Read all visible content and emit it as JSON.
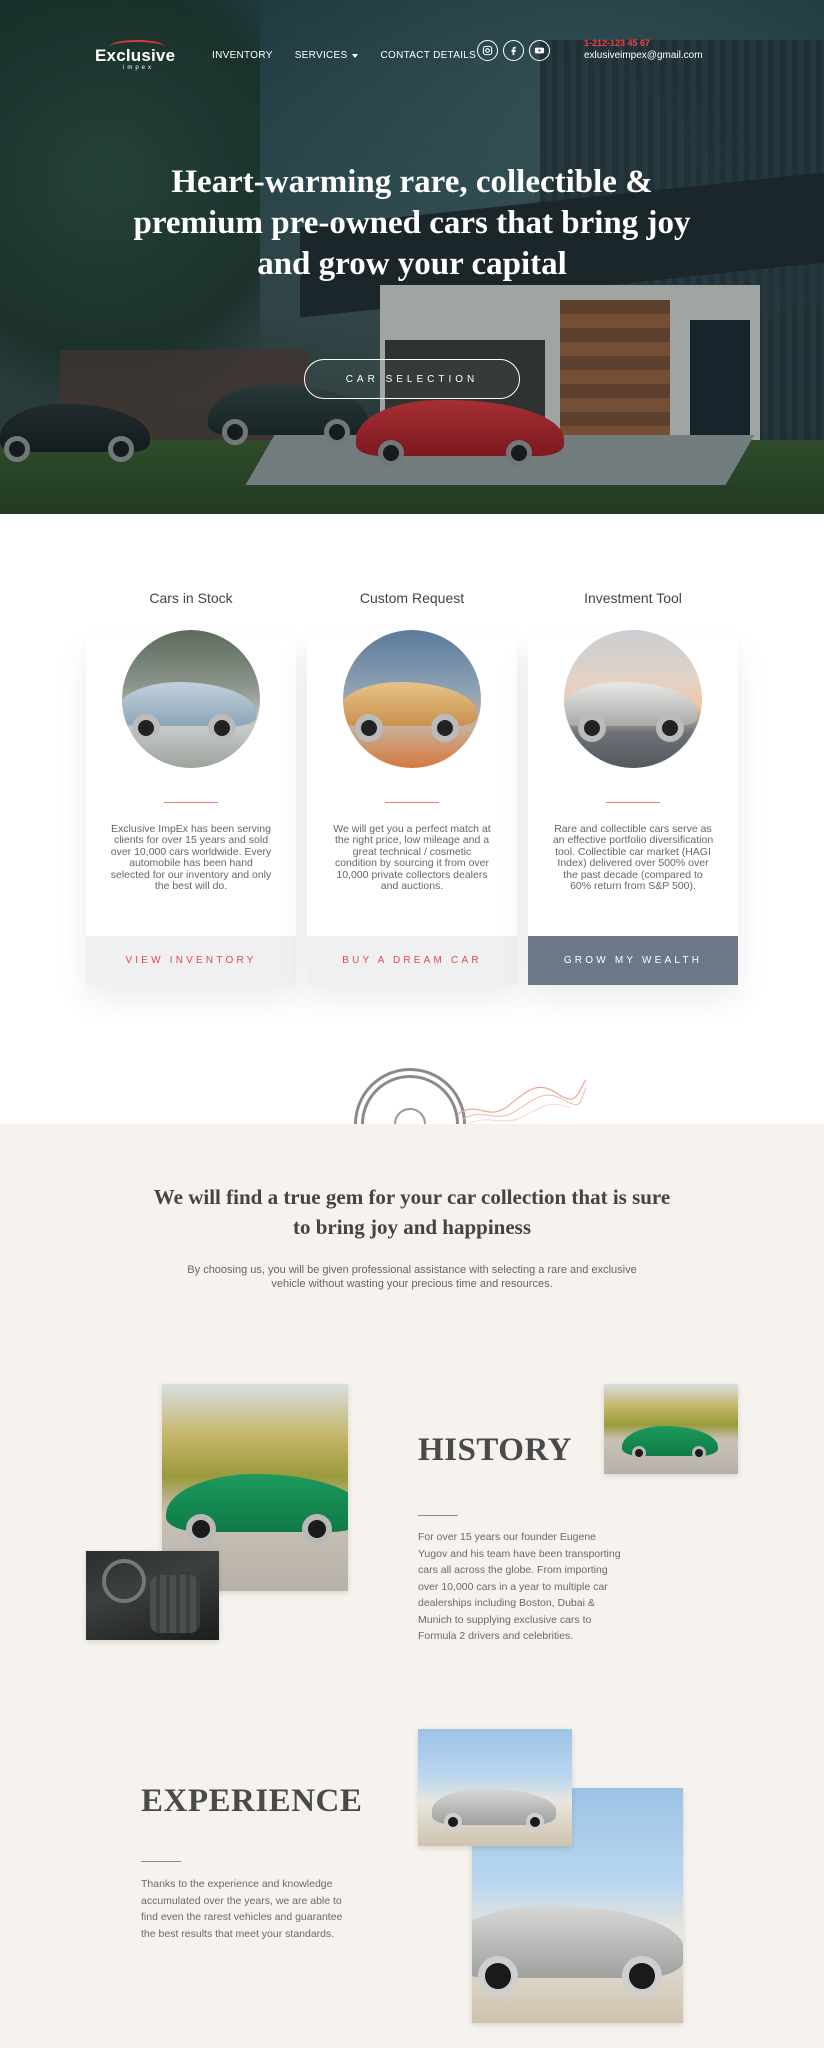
{
  "brand": {
    "name": "Exclusive",
    "sub": "impex",
    "accent": "#ef3c44"
  },
  "nav": {
    "items": [
      {
        "label": "INVENTORY"
      },
      {
        "label": "SERVICES"
      },
      {
        "label": "CONTACT DETAILS"
      }
    ]
  },
  "socials": [
    "instagram-icon",
    "facebook-icon",
    "youtube-icon"
  ],
  "contact": {
    "phone": "1-212-123 45 67",
    "email": "exlusiveimpex@gmail.com"
  },
  "hero": {
    "title": "Heart-warming rare, collectible & premium pre-owned cars that bring joy and grow your capital",
    "button": "CAR SELECTION"
  },
  "services": [
    {
      "heading": "Cars in Stock",
      "text": "Exclusive ImpEx has been serving clients for over 15 years and sold over 10,000 cars worldwide. Every automobile has been hand selected for our inventory and only the best will do.",
      "button": "VIEW INVENTORY"
    },
    {
      "heading": "Custom Request",
      "text": "We will get you a perfect match at the right price, low mileage and a great technical / cosmetic condition by sourcing it from over 10,000 private collectors dealers and auctions.",
      "button": "BUY A DREAM CAR"
    },
    {
      "heading": "Investment Tool",
      "text": "Rare and collectible cars serve as an effective portfolio diversification tool. Collectible car market (HAGI Index) delivered over 500% over the past decade (compared to 60% return from S&P 500).",
      "button": "GROW MY WEALTH"
    }
  ],
  "gem": {
    "title": "We will find a true gem for your car collection that is sure to bring joy and happiness",
    "subtitle": "By choosing us, you will be given professional assistance with selecting a rare and exclusive vehicle without wasting your precious time and resources."
  },
  "history": {
    "title": "HISTORY",
    "text": "For over 15 years our founder Eugene Yugov and his team have been transporting cars all across the globe. From importing over 10,000 cars in a year to multiple car dealerships including Boston, Dubai & Munich to supplying exclusive cars to Formula 2 drivers and celebrities."
  },
  "experience": {
    "title": "EXPERIENCE",
    "text": "Thanks to the experience and knowledge accumulated over the years, we are able to find even the rarest vehicles and guarantee the best results that meet your standards."
  }
}
